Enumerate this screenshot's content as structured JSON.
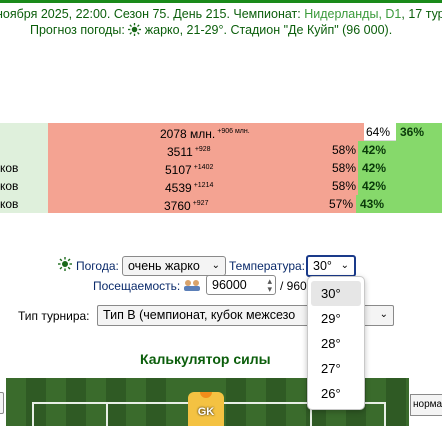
{
  "header": {
    "line1_main": "ноября 2025, 22:00. Сезон 75. День 215. Чемпионат: ",
    "line1_country": "Нидерланды, D1",
    "line1_rest": ", 17 тур.",
    "line2_prefix": "Прогноз погоды: ",
    "line2_weather": "жарко, 21-29°. Стадион \"Де Куйп\" (96 000)."
  },
  "rows": [
    {
      "name": "",
      "value": "2078 млн.",
      "delta": "+906 млн.",
      "pct1": "64%",
      "pct2": "36%"
    },
    {
      "name": "",
      "value": "3511",
      "delta": "+928",
      "pct1": "58%",
      "pct2": "42%"
    },
    {
      "name": "ков",
      "value": "5107",
      "delta": "+1402",
      "pct1": "58%",
      "pct2": "42%"
    },
    {
      "name": "ков",
      "value": "4539",
      "delta": "+1214",
      "pct1": "58%",
      "pct2": "42%"
    },
    {
      "name": "ков",
      "value": "3760",
      "delta": "+927",
      "pct1": "57%",
      "pct2": "43%"
    }
  ],
  "controls": {
    "weather_label": "Погода:",
    "weather_value": "очень жарко",
    "temperature_label": "Температура:",
    "temperature_value": "30°",
    "attendance_label": "Посещаемость:",
    "attendance_value": "96000",
    "attendance_max": "/ 960",
    "tournament_label": "Тип турнира:",
    "tournament_value": "Тип В (чемпионат, кубок межсезо"
  },
  "temperature_options": [
    "30°",
    "29°",
    "28°",
    "27°",
    "26°"
  ],
  "calc_title": "Калькулятор силы",
  "field": {
    "gk_label": "GK",
    "right_select_value": "норма"
  },
  "colors": {
    "accent_green": "#0b5e0b",
    "bar_red": "#f4a392",
    "bar_green": "#86d96b"
  }
}
